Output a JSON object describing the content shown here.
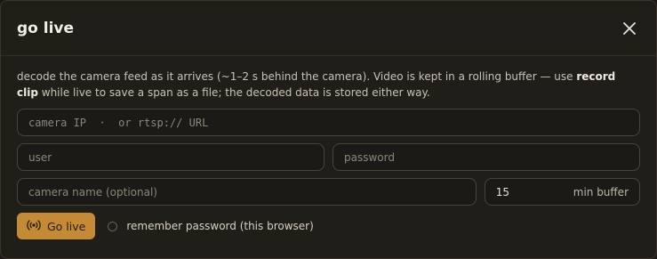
{
  "dialog": {
    "title": "go live",
    "description_part1": "decode the camera feed as it arrives (~1–2 s behind the camera). Video is kept in a rolling buffer — use ",
    "description_bold": "record clip",
    "description_part2": " while live to save a span as a file; the decoded data is stored either way."
  },
  "form": {
    "camera_placeholder": "camera IP  ·  or rtsp:// URL",
    "user_placeholder": "user",
    "password_placeholder": "password",
    "name_placeholder": "camera name (optional)",
    "buffer_value": "15",
    "buffer_unit": "min buffer"
  },
  "actions": {
    "go_live_label": "Go live",
    "go_live_icon": "broadcast-icon",
    "remember_label": "remember password (this browser)",
    "remember_checked": false
  },
  "colors": {
    "accent": "#c48a35",
    "background": "#201e19"
  }
}
